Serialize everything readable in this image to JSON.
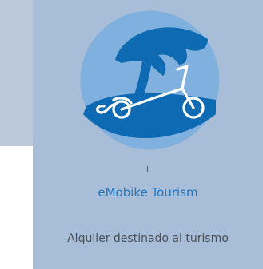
{
  "card": {
    "title": "eMobike Tourism",
    "subtitle": "Alquiler destinado al turismo",
    "logo_icon": "island-bike-icon"
  },
  "colors": {
    "page_bg": "#bcc9dd",
    "card_bg": "#a8bdd7",
    "logo_circle": "#7fb0de",
    "logo_dark": "#0d6ab3",
    "title": "#1f77c2",
    "subtitle": "#4a4f57"
  }
}
